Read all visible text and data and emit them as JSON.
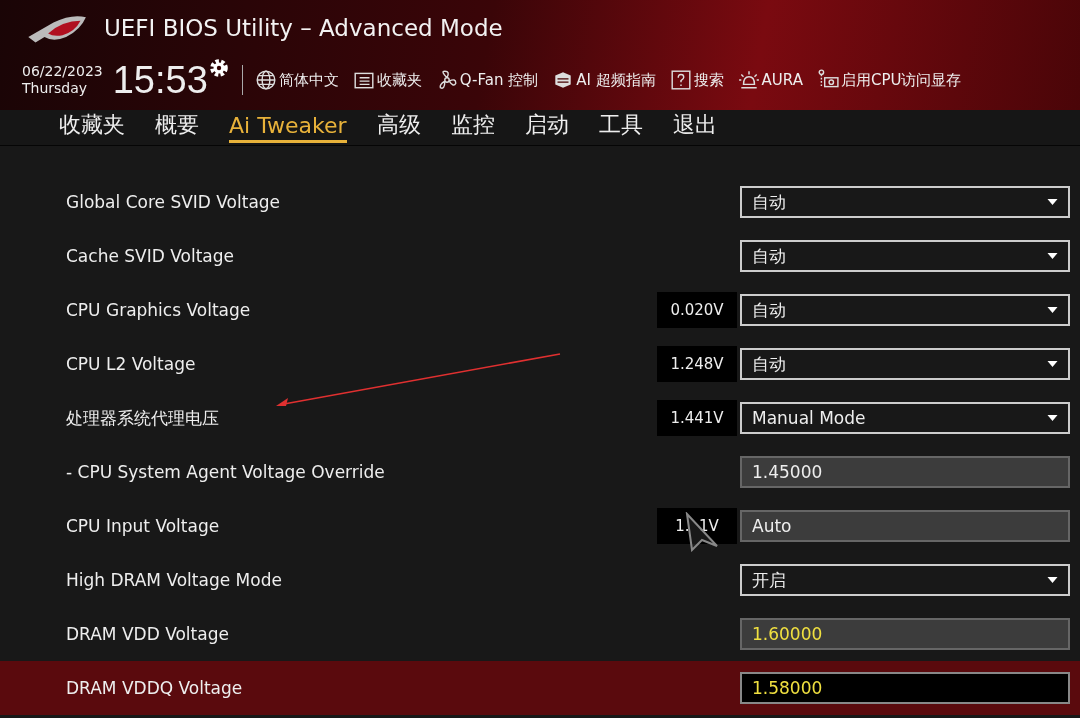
{
  "window": {
    "title": "UEFI BIOS Utility – Advanced Mode"
  },
  "date": "06/22/2023",
  "weekday": "Thursday",
  "time": "15:53",
  "toolbar": [
    {
      "label": "简体中文"
    },
    {
      "label": "收藏夹"
    },
    {
      "label": "Q-Fan 控制"
    },
    {
      "label": "AI 超频指南"
    },
    {
      "label": "搜索"
    },
    {
      "label": "AURA"
    },
    {
      "label": "启用CPU访问显存"
    }
  ],
  "tabs": [
    {
      "label": "收藏夹",
      "selected": false
    },
    {
      "label": "概要",
      "selected": false
    },
    {
      "label": "Ai Tweaker",
      "selected": true
    },
    {
      "label": "高级",
      "selected": false
    },
    {
      "label": "监控",
      "selected": false
    },
    {
      "label": "启动",
      "selected": false
    },
    {
      "label": "工具",
      "selected": false
    },
    {
      "label": "退出",
      "selected": false
    }
  ],
  "settings": [
    {
      "label": "Global Core SVID Voltage",
      "kind": "dropdown",
      "value": "自动",
      "selected": false
    },
    {
      "label": "Cache SVID Voltage",
      "kind": "dropdown",
      "value": "自动",
      "selected": false
    },
    {
      "label": "CPU Graphics Voltage",
      "kind": "dropdown",
      "reading": "0.020V",
      "value": "自动",
      "selected": false
    },
    {
      "label": "CPU L2 Voltage",
      "kind": "dropdown",
      "reading": "1.248V",
      "value": "自动",
      "selected": false
    },
    {
      "label": "处理器系统代理电压",
      "kind": "dropdown",
      "reading": "1.441V",
      "value": "Manual Mode",
      "selected": false
    },
    {
      "label": "- CPU System Agent Voltage Override",
      "kind": "field",
      "value": "1.45000",
      "selected": false
    },
    {
      "label": "CPU Input Voltage",
      "kind": "field",
      "reading": "1.  1V",
      "value": "Auto",
      "selected": false
    },
    {
      "label": "High DRAM Voltage Mode",
      "kind": "dropdown",
      "value": "开启",
      "selected": false
    },
    {
      "label": "DRAM VDD Voltage",
      "kind": "number",
      "value": "1.60000",
      "selected": false
    },
    {
      "label": "DRAM VDDQ Voltage",
      "kind": "number",
      "value": "1.58000",
      "selected": true
    }
  ]
}
